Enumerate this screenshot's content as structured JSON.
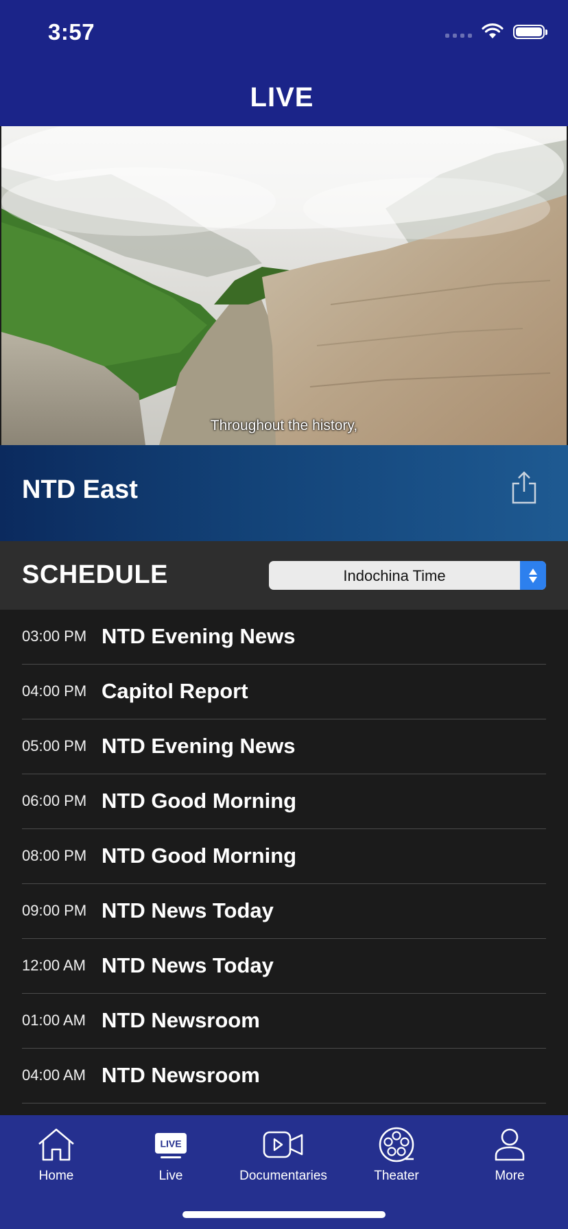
{
  "status_bar": {
    "time": "3:57"
  },
  "nav": {
    "title": "LIVE"
  },
  "player": {
    "subtitle": "Throughout the history,"
  },
  "channel": {
    "name": "NTD East"
  },
  "schedule": {
    "title": "SCHEDULE",
    "timezone": "Indochina Time",
    "items": [
      {
        "time": "03:00 PM",
        "title": "NTD Evening News"
      },
      {
        "time": "04:00 PM",
        "title": "Capitol Report"
      },
      {
        "time": "05:00 PM",
        "title": "NTD Evening News"
      },
      {
        "time": "06:00 PM",
        "title": "NTD Good Morning"
      },
      {
        "time": "08:00 PM",
        "title": "NTD Good Morning"
      },
      {
        "time": "09:00 PM",
        "title": "NTD News Today"
      },
      {
        "time": "12:00 AM",
        "title": "NTD News Today"
      },
      {
        "time": "01:00 AM",
        "title": "NTD Newsroom"
      },
      {
        "time": "04:00 AM",
        "title": "NTD Newsroom"
      }
    ]
  },
  "tabs": [
    {
      "label": "Home",
      "icon": "home-icon"
    },
    {
      "label": "Live",
      "icon": "live-icon",
      "badge": "LIVE"
    },
    {
      "label": "Documentaries",
      "icon": "video-camera-icon"
    },
    {
      "label": "Theater",
      "icon": "film-reel-icon"
    },
    {
      "label": "More",
      "icon": "person-icon"
    }
  ],
  "colors": {
    "header": "#1b2489",
    "tab_bar": "#25308f",
    "list_bg": "#1b1b1b",
    "schedule_header": "#2e2e2e",
    "select_accent": "#2d80ee"
  }
}
